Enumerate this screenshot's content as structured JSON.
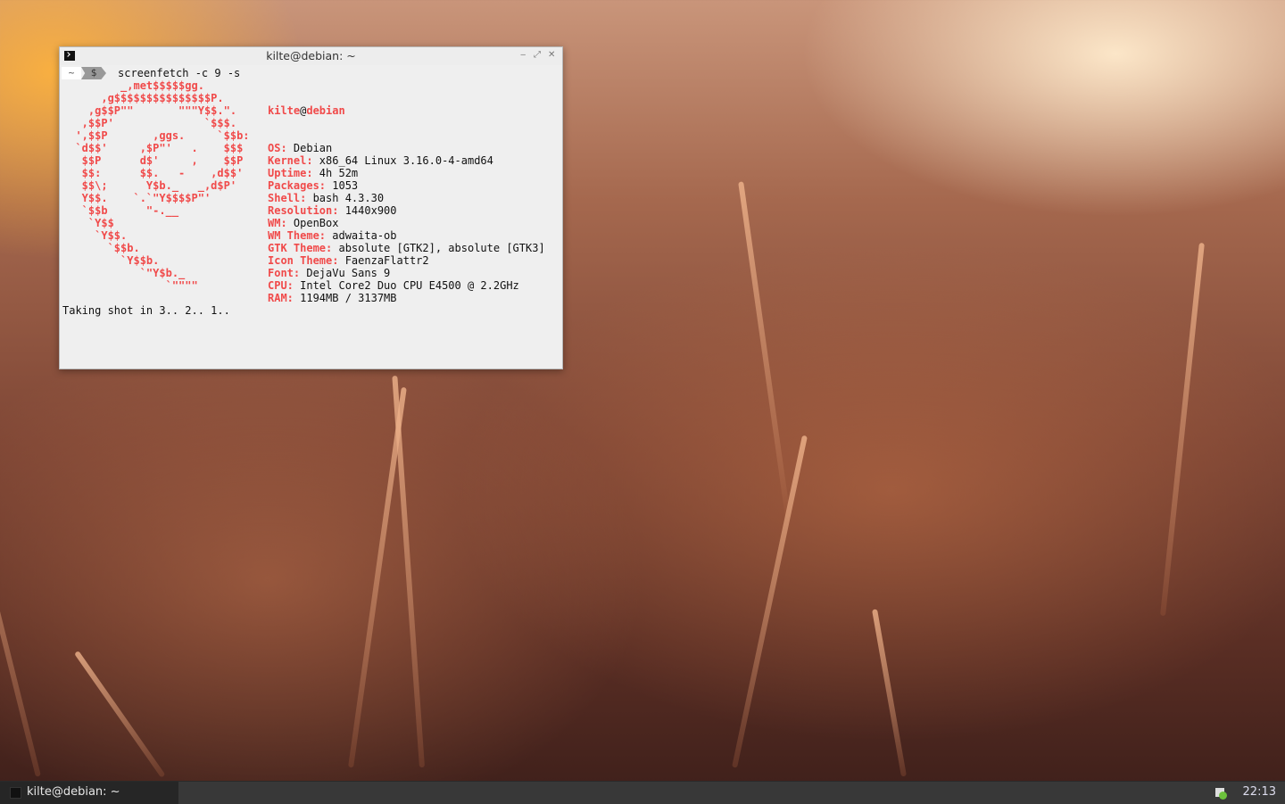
{
  "window": {
    "title": "kilte@debian: ~",
    "minimize": "‒",
    "maximize": "⤢",
    "close": "✕"
  },
  "prompt": {
    "dir": "~",
    "symbol": "$",
    "command": "screenfetch -c 9 -s"
  },
  "art": [
    "         _,met$$$$$gg.",
    "      ,g$$$$$$$$$$$$$$$P.",
    "    ,g$$P\"\"       \"\"\"Y$$.\".",
    "   ,$$P'              `$$$.",
    "  ',$$P       ,ggs.     `$$b:",
    "  `d$$'     ,$P\"'   .    $$$",
    "   $$P      d$'     ,    $$P",
    "   $$:      $$.   -    ,d$$'",
    "   $$\\;      Y$b._   _,d$P'",
    "   Y$$.    `.`\"Y$$$$P\"'",
    "   `$$b      \"-.__",
    "    `Y$$",
    "     `Y$$.",
    "       `$$b.",
    "         `Y$$b.",
    "            `\"Y$b._",
    "                `\"\"\"\""
  ],
  "userhost": {
    "user": "kilte",
    "at": "@",
    "host": "debian"
  },
  "info": [
    {
      "label": "OS:",
      "value": " Debian"
    },
    {
      "label": "Kernel:",
      "value": " x86_64 Linux 3.16.0-4-amd64"
    },
    {
      "label": "Uptime:",
      "value": " 4h 52m"
    },
    {
      "label": "Packages:",
      "value": " 1053"
    },
    {
      "label": "Shell:",
      "value": " bash 4.3.30"
    },
    {
      "label": "Resolution:",
      "value": " 1440x900"
    },
    {
      "label": "WM:",
      "value": " OpenBox"
    },
    {
      "label": "WM Theme:",
      "value": " adwaita-ob"
    },
    {
      "label": "GTK Theme:",
      "value": " absolute [GTK2], absolute [GTK3]"
    },
    {
      "label": "Icon Theme:",
      "value": " FaenzaFlattr2"
    },
    {
      "label": "Font:",
      "value": " DejaVu Sans 9"
    },
    {
      "label": "CPU:",
      "value": " Intel Core2 Duo CPU E4500 @ 2.2GHz"
    },
    {
      "label": "RAM:",
      "value": " 1194MB / 3137MB"
    }
  ],
  "status_line": "Taking shot in 3.. 2.. 1..",
  "taskbar": {
    "task_label": "kilte@debian: ~",
    "clock": "22:13"
  }
}
